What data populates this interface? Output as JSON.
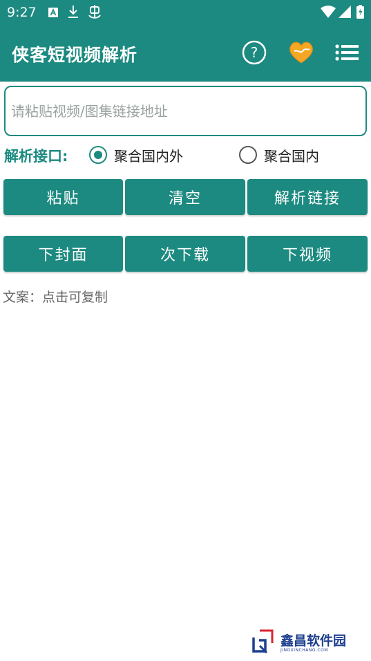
{
  "status_bar": {
    "time": "9:27",
    "left_icons": [
      "a-badge-icon",
      "download-icon",
      "bug-icon"
    ],
    "right_icons": [
      "wifi-icon",
      "signal-icon",
      "battery-charging-icon"
    ]
  },
  "toolbar": {
    "title": "侠客短视频解析",
    "icons": [
      "help-icon",
      "heart-icon",
      "menu-list-icon"
    ]
  },
  "url_input": {
    "placeholder": "请粘贴视频/图集链接地址",
    "value": ""
  },
  "api_selector": {
    "label": "解析接口:",
    "options": [
      {
        "label": "聚合国内外",
        "checked": true
      },
      {
        "label": "聚合国内",
        "checked": false
      }
    ]
  },
  "action_buttons_row1": [
    "粘贴",
    "清空",
    "解析链接"
  ],
  "action_buttons_row2": [
    "下封面",
    "次下载",
    "下视频"
  ],
  "copy_hint": "文案：点击可复制",
  "watermark": {
    "text": "鑫昌软件园",
    "sub": "JINGXINCHANG.COM"
  },
  "colors": {
    "primary": "#1c8a80",
    "heart": "#f5a623",
    "watermark": "#1d3f8f"
  }
}
